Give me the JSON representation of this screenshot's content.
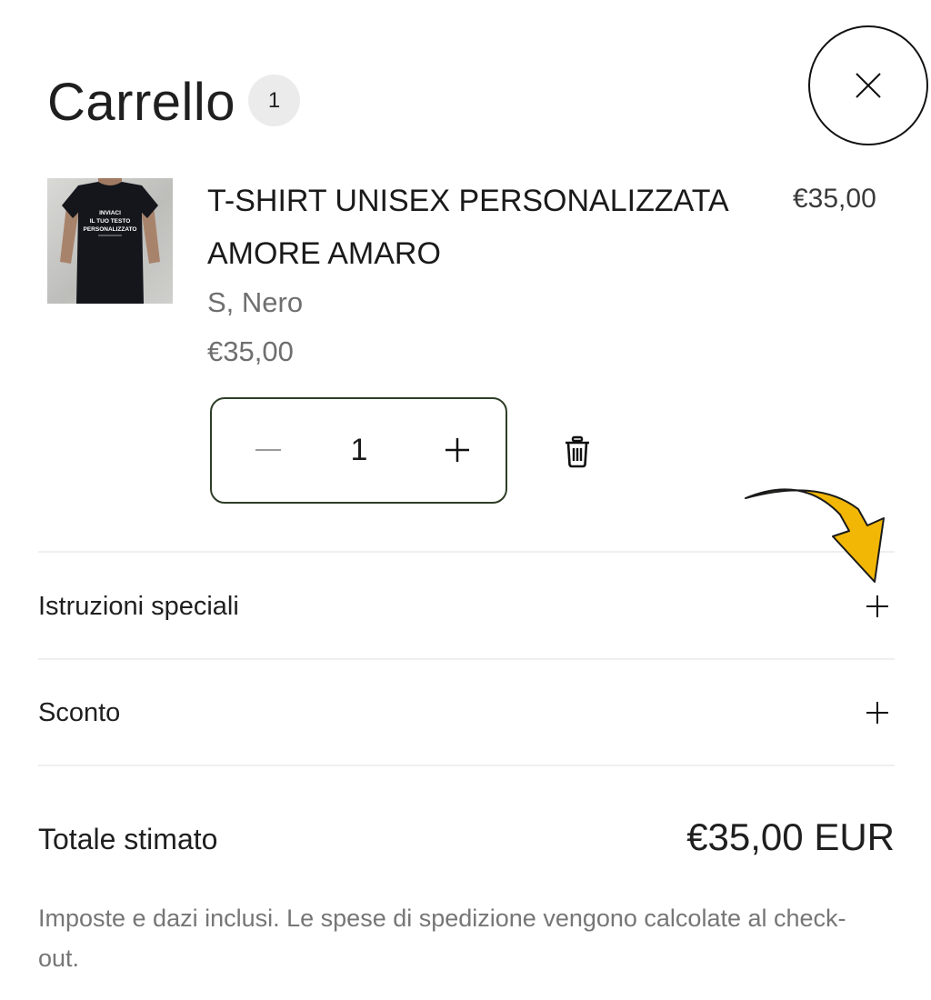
{
  "header": {
    "title": "Carrello",
    "item_count": "1"
  },
  "cart_item": {
    "name": "T-SHIRT UNISEX PERSONALIZZATA AMORE AMARO",
    "line_price": "€35,00",
    "variant": "S,  Nero",
    "unit_price": "€35,00",
    "quantity": "1",
    "image_text": [
      "INVIACI",
      "IL TUO TESTO",
      "PERSONALIZZATO"
    ]
  },
  "sections": [
    {
      "label": "Istruzioni speciali"
    },
    {
      "label": "Sconto"
    }
  ],
  "summary": {
    "total_label": "Totale stimato",
    "total_value": "€35,00 EUR",
    "tax_note": "Imposte e dazi inclusi. Le spese di spedizione vengono calcolate al check-out."
  },
  "icons": {
    "close": "close-icon",
    "minus": "minus-icon",
    "plus": "plus-icon",
    "trash": "trash-icon",
    "expand": "plus-icon",
    "annotation": "arrow-icon"
  },
  "colors": {
    "quantity_border": "#2e3d26",
    "badge_background": "#ebebeb",
    "annotation_arrow": "#f2b705"
  }
}
